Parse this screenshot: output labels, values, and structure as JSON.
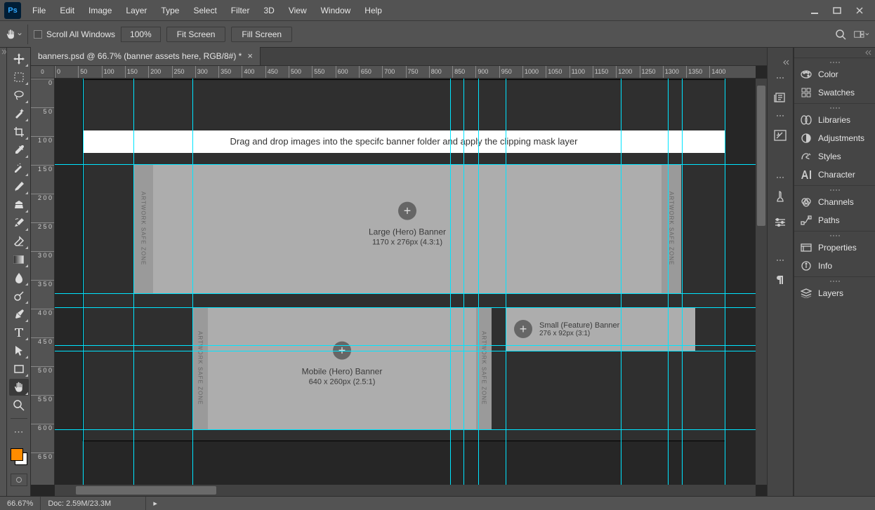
{
  "menu": [
    "File",
    "Edit",
    "Image",
    "Layer",
    "Type",
    "Select",
    "Filter",
    "3D",
    "View",
    "Window",
    "Help"
  ],
  "options": {
    "scroll_all": "Scroll All Windows",
    "zoom": "100%",
    "fit": "Fit Screen",
    "fill": "Fill Screen"
  },
  "document": {
    "tab": "banners.psd @ 66.7% (banner assets here, RGB/8#) *",
    "ruler_corner": "0"
  },
  "ruler_top": [
    0,
    50,
    100,
    150,
    200,
    250,
    300,
    350,
    400,
    450,
    500,
    550,
    600,
    650,
    700,
    750,
    800,
    850,
    900,
    950,
    1000,
    1050,
    1100,
    1150,
    1200,
    1250,
    1300,
    1350,
    1400
  ],
  "ruler_left": [
    "0",
    "5 0",
    "1 0 0",
    "1 5 0",
    "2 0 0",
    "2 5 0",
    "3 0 0",
    "3 5 0",
    "4 0 0",
    "4 5 0",
    "5 0 0",
    "5 5 0",
    "6 0 0",
    "6 5 0"
  ],
  "canvas": {
    "instruction": "Drag and drop images into the specifc banner folder and apply the clipping mask layer",
    "safe_zone": "ARTWORK SAFE ZONE",
    "hero_title": "Large (Hero) Banner",
    "hero_size": "1170 x 276px (4.3:1)",
    "mobile_title": "Mobile (Hero) Banner",
    "mobile_size": "640 x 260px (2.5:1)",
    "feature_title": "Small (Feature) Banner",
    "feature_size": "276 x 92px (3:1)"
  },
  "panels": {
    "group1": [
      "Color",
      "Swatches"
    ],
    "group2": [
      "Libraries",
      "Adjustments",
      "Styles",
      "Character"
    ],
    "group3": [
      "Channels",
      "Paths"
    ],
    "group4": [
      "Properties",
      "Info"
    ],
    "group5": [
      "Layers"
    ]
  },
  "status": {
    "zoom": "66.67%",
    "doc": "Doc: 2.59M/23.3M"
  },
  "colors": {
    "fg": "#ff8c00",
    "bg": "#ffffff"
  }
}
